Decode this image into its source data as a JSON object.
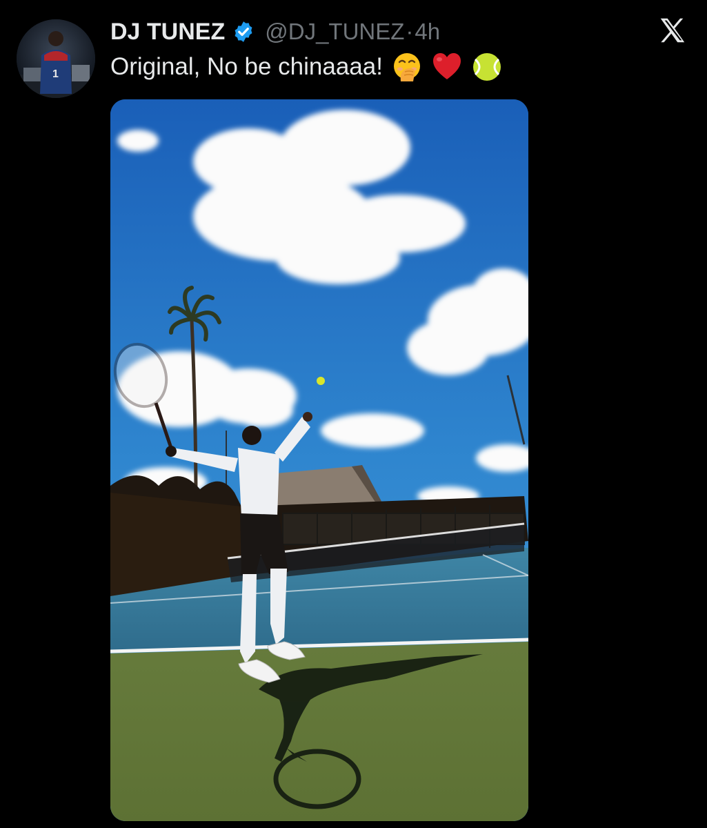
{
  "tweet": {
    "author": {
      "name": "DJ TUNEZ",
      "handle": "@DJ_TUNEZ",
      "verified": true,
      "avatar_jersey_number": "1"
    },
    "separator": "·",
    "time": "4h",
    "text": "Original, No be chinaaaa!",
    "emojis": [
      "face-with-hand-over-mouth",
      "red-heart",
      "tennis-ball"
    ],
    "media": {
      "type": "photo",
      "alt": ""
    }
  },
  "app": {
    "logo": "x-logo"
  },
  "colors": {
    "background": "#000000",
    "text": "#e7e9ea",
    "secondary": "#71767b",
    "verified": "#1d9bf0"
  }
}
